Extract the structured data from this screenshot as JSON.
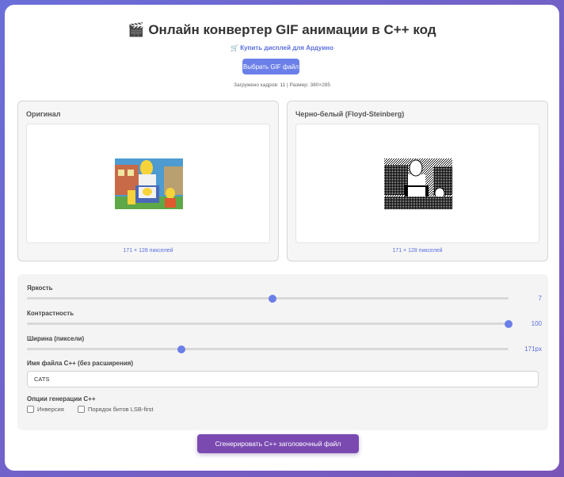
{
  "header": {
    "icon": "🎬",
    "title": "Онлайн конвертер GIF анимации в C++ код",
    "buy_icon": "🛒",
    "buy_link": "Купить дисплей для Ардуино",
    "select_button": "Выбрать GIF файл",
    "info": "Загружено кадров: 11 | Размер: 380×285"
  },
  "panels": {
    "original": {
      "title": "Оригинал",
      "size_label": "171 × 128 пикселей"
    },
    "bw": {
      "title": "Черно-белый (Floyd-Steinberg)",
      "size_label": "171 × 128 пикселей"
    }
  },
  "controls": {
    "brightness": {
      "label": "Яркость",
      "value": "7",
      "fraction": 0.51
    },
    "contrast": {
      "label": "Контрастность",
      "value": "100",
      "fraction": 1.0
    },
    "width": {
      "label": "Ширина (пиксели)",
      "value": "171px",
      "fraction": 0.32
    },
    "filename": {
      "label": "Имя файла C++ (без расширения)",
      "value": "CATS"
    },
    "options": {
      "label": "Опции генерации C++",
      "invert": "Инверсия",
      "lsb": "Порядок битов LSB-first"
    }
  },
  "generate_button": "Сгенерировать C++ заголовочный файл",
  "colors": {
    "accent": "#6b7fe8",
    "generate": "#7a4ab0"
  }
}
